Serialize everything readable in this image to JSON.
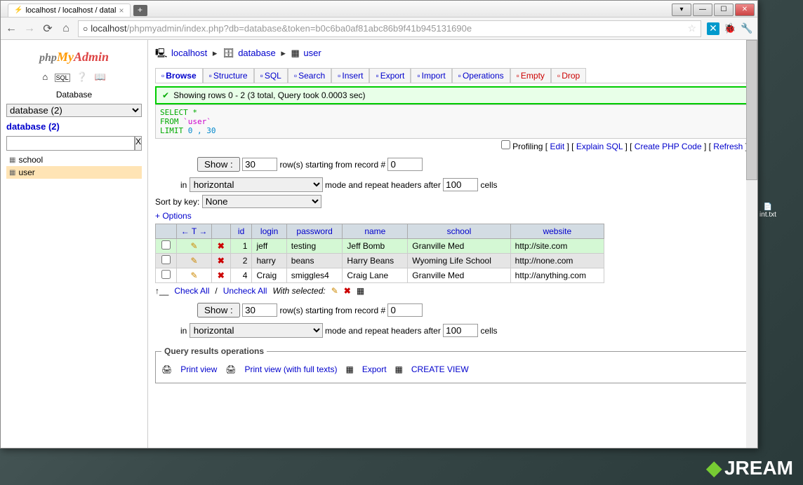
{
  "browser": {
    "tab_title": "localhost / localhost / datal",
    "url_host": "localhost",
    "url_path": "/phpmyadmin/index.php?db=database&token=b0c6ba0af81abc86b9f41b945131690e"
  },
  "sidebar": {
    "label": "Database",
    "select_value": "database (2)",
    "db_link": "database (2)",
    "filter_value": "",
    "tables": [
      {
        "name": "school",
        "selected": false
      },
      {
        "name": "user",
        "selected": true
      }
    ]
  },
  "breadcrumb": {
    "server": "localhost",
    "database": "database",
    "table": "user"
  },
  "tabs": [
    {
      "label": "Browse",
      "active": true
    },
    {
      "label": "Structure"
    },
    {
      "label": "SQL"
    },
    {
      "label": "Search"
    },
    {
      "label": "Insert"
    },
    {
      "label": "Export"
    },
    {
      "label": "Import"
    },
    {
      "label": "Operations"
    },
    {
      "label": "Empty",
      "danger": true
    },
    {
      "label": "Drop",
      "danger": true
    }
  ],
  "message": "Showing rows 0 - 2 (3 total, Query took 0.0003 sec)",
  "sql": {
    "select": "SELECT *",
    "from": "FROM `user`",
    "limit": "LIMIT 0 , 30"
  },
  "sql_links": {
    "profiling": "Profiling",
    "edit": "Edit",
    "explain": "Explain SQL",
    "php": "Create PHP Code",
    "refresh": "Refresh"
  },
  "show_controls": {
    "show_btn": "Show :",
    "show_val": "30",
    "row_text": "row(s) starting from record #",
    "start_val": "0",
    "in_text": "in",
    "mode_val": "horizontal",
    "mode_text": "mode and repeat headers after",
    "repeat_val": "100",
    "cells_text": "cells"
  },
  "sort_by": {
    "label": "Sort by key:",
    "value": "None"
  },
  "options_link": "+ Options",
  "columns": [
    "id",
    "login",
    "password",
    "name",
    "school",
    "website"
  ],
  "rows": [
    {
      "id": "1",
      "login": "jeff",
      "password": "testing",
      "name": "Jeff Bomb",
      "school": "Granville Med",
      "website": "http://site.com",
      "hl": true
    },
    {
      "id": "2",
      "login": "harry",
      "password": "beans",
      "name": "Harry Beans",
      "school": "Wyoming Life School",
      "website": "http://none.com"
    },
    {
      "id": "4",
      "login": "Craig",
      "password": "smiggles4",
      "name": "Craig Lane",
      "school": "Granville Med",
      "website": "http://anything.com"
    }
  ],
  "row_actions": {
    "check_all": "Check All",
    "uncheck_all": "Uncheck All",
    "with_selected": "With selected:"
  },
  "query_ops": {
    "legend": "Query results operations",
    "print": "Print view",
    "print_full": "Print view (with full texts)",
    "export": "Export",
    "create_view": "CREATE VIEW"
  },
  "desktop_file": "int.txt",
  "brand": "JREAM"
}
